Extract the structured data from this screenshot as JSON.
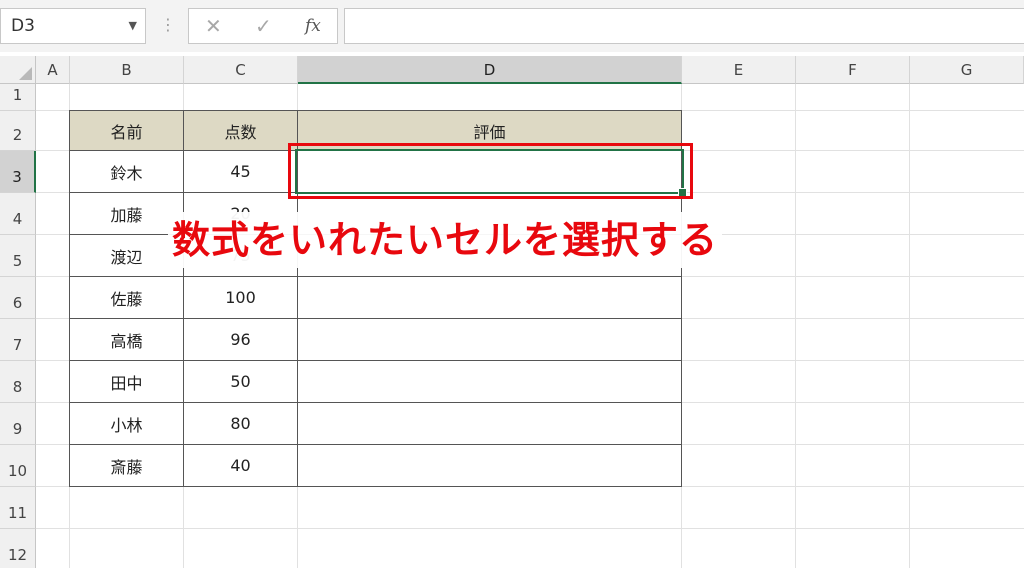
{
  "formula_bar": {
    "name_box": "D3",
    "cancel_icon": "close-icon",
    "enter_icon": "check-icon",
    "fx_label": "fx",
    "formula_value": ""
  },
  "columns": [
    "A",
    "B",
    "C",
    "D",
    "E",
    "F",
    "G"
  ],
  "rows": [
    "1",
    "2",
    "3",
    "4",
    "5",
    "6",
    "7",
    "8",
    "9",
    "10",
    "11",
    "12"
  ],
  "selected_cell": {
    "column": "D",
    "row": "3"
  },
  "table": {
    "headers": {
      "name": "名前",
      "score": "点数",
      "rating": "評価"
    },
    "rows": [
      {
        "name": "鈴木",
        "score": "45",
        "rating": ""
      },
      {
        "name": "加藤",
        "score": "20",
        "rating": ""
      },
      {
        "name": "渡辺",
        "score": "75",
        "rating": ""
      },
      {
        "name": "佐藤",
        "score": "100",
        "rating": ""
      },
      {
        "name": "高橋",
        "score": "96",
        "rating": ""
      },
      {
        "name": "田中",
        "score": "50",
        "rating": ""
      },
      {
        "name": "小林",
        "score": "80",
        "rating": ""
      },
      {
        "name": "斎藤",
        "score": "40",
        "rating": ""
      }
    ]
  },
  "annotation": {
    "caption": "数式をいれたいセルを選択する",
    "color": "#e8080e"
  },
  "colors": {
    "header_fill": "#ddd9c4",
    "selection": "#217346"
  }
}
